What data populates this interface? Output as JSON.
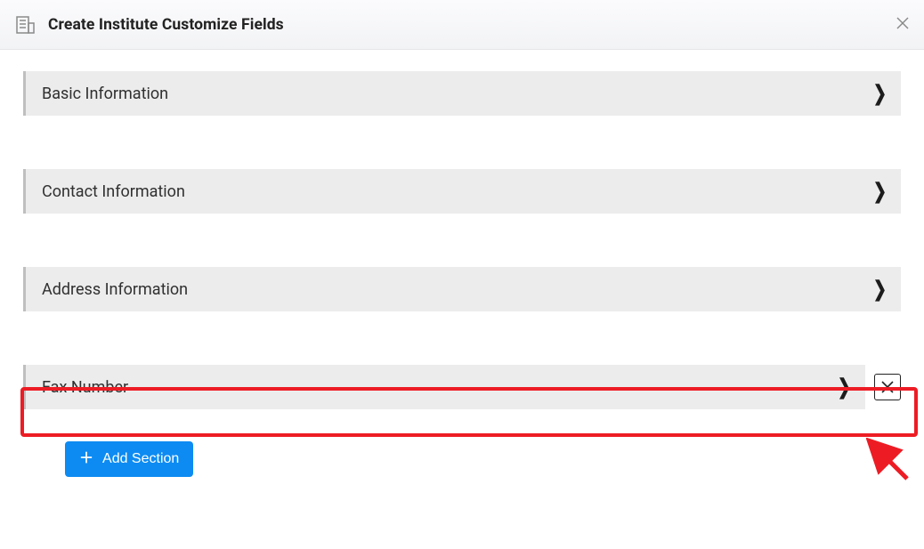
{
  "header": {
    "title": "Create Institute Customize Fields"
  },
  "sections": [
    {
      "label": "Basic Information",
      "removable": false
    },
    {
      "label": "Contact Information",
      "removable": false
    },
    {
      "label": "Address Information",
      "removable": false
    },
    {
      "label": "Fax Number",
      "removable": true
    }
  ],
  "buttons": {
    "add_section": "Add Section"
  },
  "highlightIndex": 3
}
